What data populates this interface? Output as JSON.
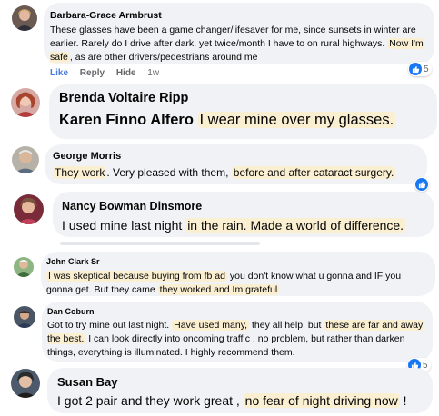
{
  "comments": [
    {
      "name": "Barbara-Grace Armbrust",
      "text_a": "These glasses have been a game changer/lifesaver for me, since sunsets in winter are earlier. Rarely do I drive after dark, yet twice/month I have to on rural highways. ",
      "text_hl": "Now I'm safe",
      "text_b": ", as are other drivers/pedestrians around me",
      "actions": {
        "like": "Like",
        "reply": "Reply",
        "hide": "Hide",
        "time": "1w"
      },
      "reactions": "5"
    },
    {
      "name": "Brenda Voltaire Ripp",
      "tagged": "Karen Finno Alfero",
      "text_hl": "I wear mine over my glasses."
    },
    {
      "name": "George Morris",
      "text_hl1": "They work",
      "text_mid": ". Very pleased with them, ",
      "text_hl2": "before and after cataract surgery."
    },
    {
      "name": "Nancy Bowman Dinsmore",
      "text_a": "I used mine last night ",
      "text_hl": "in the rain. Made a world of difference."
    },
    {
      "name": "John Clark Sr",
      "text_hl1": "I was skeptical because buying from fb ad",
      "text_mid": " you don't know what u gonna and IF you gonna get. But they came ",
      "text_hl2": "they worked and Im grateful"
    },
    {
      "name": "Dan Coburn",
      "text_a": "Got to try mine out last night. ",
      "text_hl1": "Have used many,",
      "text_mid": " they all help, but ",
      "text_hl2": "these are far and away the best.",
      "text_b": " I can look directly into oncoming traffic , no problem, but rather than darken things, everything is illuminated. I highly recommend them.",
      "reactions": "5"
    },
    {
      "name": "Susan Bay",
      "text_a": "I got 2 pair and they work great , ",
      "text_hl": "no fear of night driving now",
      "text_b": " !"
    }
  ],
  "colors": {
    "bubble": "#f0f2f5",
    "highlight": "#fbefd2",
    "link": "#4b7bd8",
    "like_blue": "#1877f2"
  },
  "icons": {
    "reaction": "like-thumb-icon",
    "avatar": "profile-photo"
  }
}
